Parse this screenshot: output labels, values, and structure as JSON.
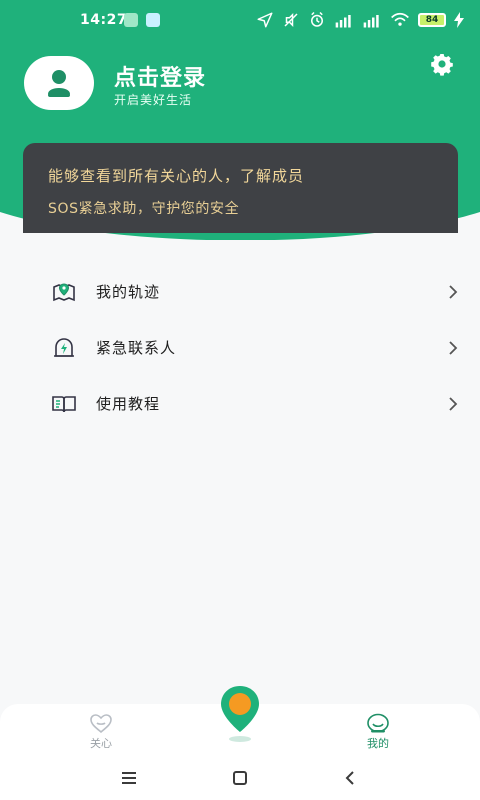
{
  "status_bar": {
    "time": "14:27",
    "battery": "84"
  },
  "header": {
    "login_title": "点击登录",
    "login_subtitle": "开启美好生活",
    "settings_icon": "gear-icon",
    "avatar_icon": "user-avatar-icon",
    "colors": {
      "primary_green": "#1fb17b",
      "banner_dark": "#3f4145",
      "banner_text": "#f2d79a"
    }
  },
  "banner": {
    "title": "能够查看到所有关心的人，了解成员",
    "subtitle": "SOS紧急求助，守护您的安全"
  },
  "menu": {
    "items": [
      {
        "label": "我的轨迹",
        "icon": "map-pin-icon"
      },
      {
        "label": "紧急联系人",
        "icon": "emergency-bolt-icon"
      },
      {
        "label": "使用教程",
        "icon": "book-icon"
      }
    ],
    "arrow_icon": "chevron-right-icon"
  },
  "bottom_nav": {
    "tabs": [
      {
        "label": "关心",
        "icon": "heart-icon",
        "active": false
      },
      {
        "label": "我的",
        "icon": "profile-smile-icon",
        "active": true
      }
    ],
    "center_icon": "location-pin-icon"
  },
  "system_nav": {
    "menu_icon": "menu-icon",
    "home_icon": "home-icon",
    "back_icon": "back-icon"
  }
}
